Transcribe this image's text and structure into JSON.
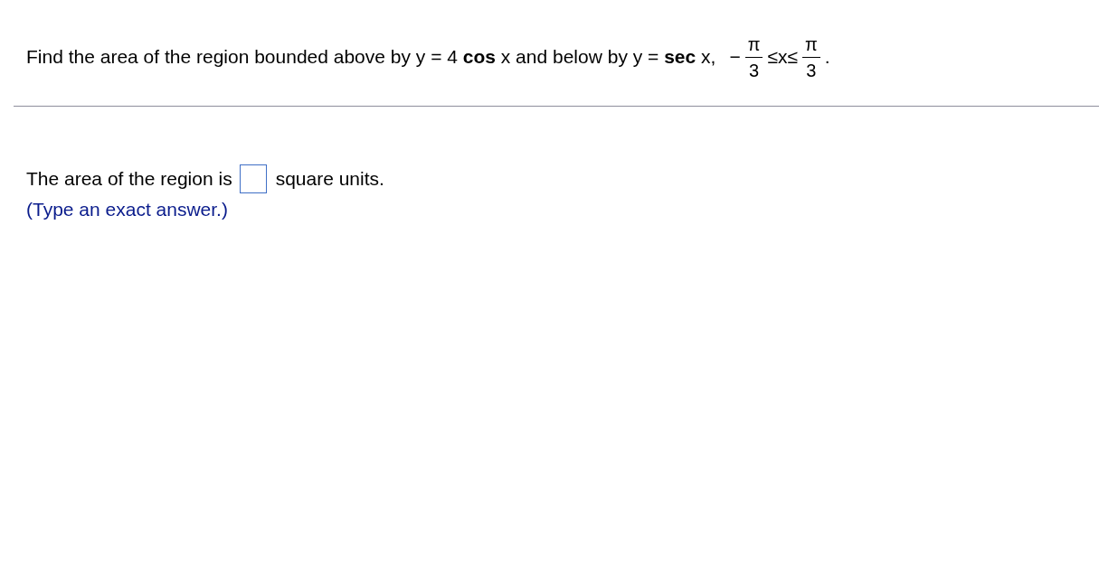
{
  "question": {
    "text": "Find the area of the region bounded above by y = 4 **cos** x and below by y = **sec** x,",
    "bounds": [
      {
        "kind": "sign",
        "text": "−"
      },
      {
        "kind": "fraction",
        "numerator": "π",
        "denominator": "3"
      },
      {
        "kind": "sign",
        "text": "≤x≤"
      },
      {
        "kind": "fraction",
        "numerator": "π",
        "denominator": "3"
      },
      {
        "kind": "sign",
        "text": "."
      }
    ]
  },
  "answer": {
    "prefix": "The area of the region is",
    "suffix": "square units.",
    "hint": "(Type an exact answer.)"
  }
}
